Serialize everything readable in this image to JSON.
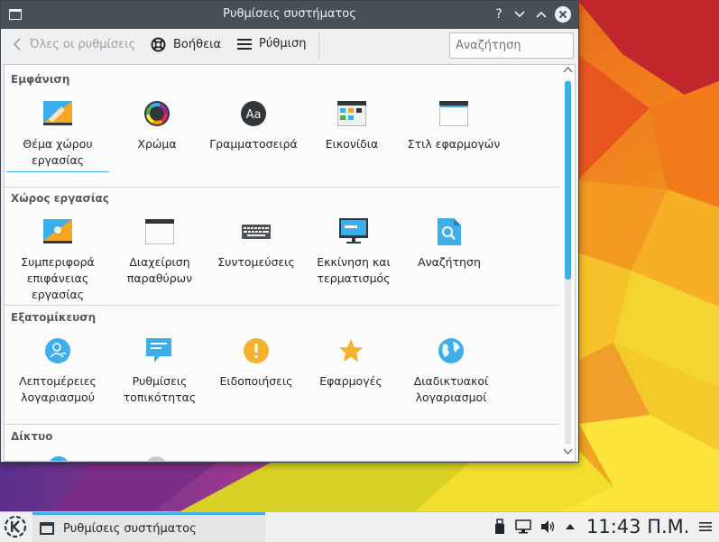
{
  "window": {
    "title": "Ρυθμίσεις συστήματος",
    "help_button": "?",
    "minimize_button": "⌄",
    "maximize_button": "⌃",
    "close_button": "✕"
  },
  "toolbar": {
    "back_label": "Όλες οι ρυθμίσεις",
    "help_label": "Βοήθεια",
    "configure_label": "Ρύθμιση",
    "search_placeholder": "Αναζήτηση"
  },
  "sections": [
    {
      "title": "Εμφάνιση",
      "items": [
        {
          "label": "Θέμα χώρου εργασίας",
          "icon": "workspace-theme-icon"
        },
        {
          "label": "Χρώμα",
          "icon": "color-icon"
        },
        {
          "label": "Γραμματοσειρά",
          "icon": "font-icon"
        },
        {
          "label": "Εικονίδια",
          "icon": "icons-icon"
        },
        {
          "label": "Στιλ εφαρμογών",
          "icon": "application-style-icon"
        }
      ]
    },
    {
      "title": "Χώρος εργασίας",
      "items": [
        {
          "label": "Συμπεριφορά επιφάνειας εργασίας",
          "icon": "desktop-behavior-icon"
        },
        {
          "label": "Διαχείριση παραθύρων",
          "icon": "window-management-icon"
        },
        {
          "label": "Συντομεύσεις",
          "icon": "keyboard-icon"
        },
        {
          "label": "Εκκίνηση και τερματισμός",
          "icon": "startup-shutdown-icon"
        },
        {
          "label": "Αναζήτηση",
          "icon": "search-file-icon"
        }
      ]
    },
    {
      "title": "Εξατομίκευση",
      "items": [
        {
          "label": "Λεπτομέρειες λογαριασμού",
          "icon": "account-icon"
        },
        {
          "label": "Ρυθμίσεις τοπικότητας",
          "icon": "locale-icon"
        },
        {
          "label": "Ειδοποιήσεις",
          "icon": "notification-icon"
        },
        {
          "label": "Εφαρμογές",
          "icon": "star-icon"
        },
        {
          "label": "Διαδικτυακοί λογαριασμοί",
          "icon": "globe-icon"
        }
      ]
    },
    {
      "title": "Δίκτυο",
      "items": []
    }
  ],
  "taskbar": {
    "task_label": "Ρυθμίσεις συστήματος",
    "clock": "11:43 Π.Μ."
  },
  "colors": {
    "accent": "#3daee9",
    "titlebar": "#475057",
    "window_bg": "#eff0f1"
  }
}
